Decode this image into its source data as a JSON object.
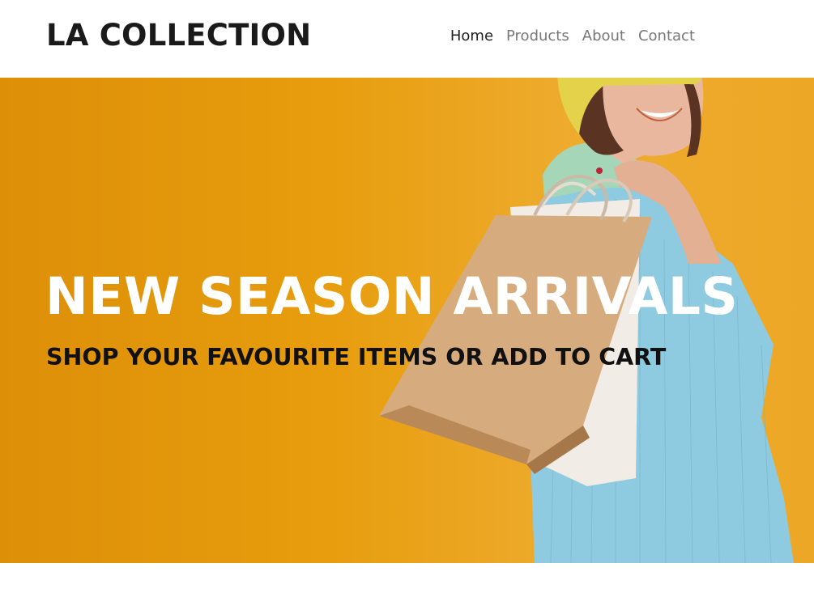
{
  "brand": {
    "name": "LA COLLECTION"
  },
  "nav": {
    "items": [
      {
        "label": "Home",
        "active": true
      },
      {
        "label": "Products",
        "active": false
      },
      {
        "label": "About",
        "active": false
      },
      {
        "label": "Contact",
        "active": false
      }
    ]
  },
  "hero": {
    "title": "NEW SEASON ARRIVALS",
    "subtitle": "SHOP YOUR FAVOURITE ITEMS OR ADD TO CART",
    "image": "woman-with-shopping-bags-photo",
    "colors": {
      "background": "#e79d0d",
      "title": "#ffffff",
      "subtitle": "#111111",
      "jacket": "#8ccbe2",
      "hat": "#e6d24c"
    }
  }
}
